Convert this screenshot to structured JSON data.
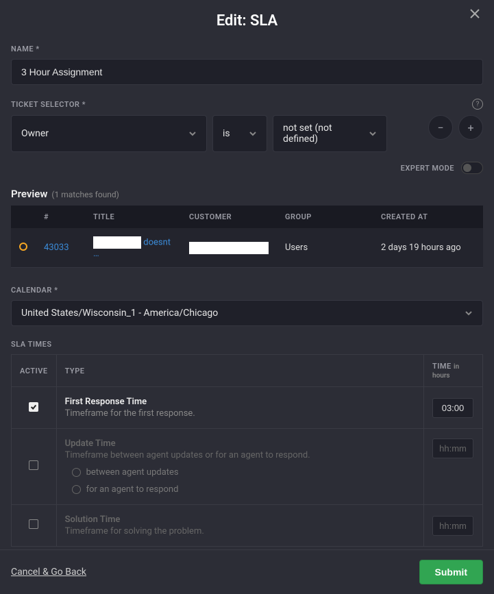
{
  "header": {
    "title": "Edit: SLA"
  },
  "name": {
    "label": "NAME *",
    "value": "3 Hour Assignment"
  },
  "ticket_selector": {
    "label": "TICKET SELECTOR *",
    "attribute": "Owner",
    "operator": "is",
    "value": "not set (not defined)"
  },
  "expert_mode": {
    "label": "EXPERT MODE",
    "enabled": false
  },
  "preview": {
    "title": "Preview",
    "count_text": "(1 matches found)",
    "columns": {
      "hash": "#",
      "title": "TITLE",
      "customer": "CUSTOMER",
      "group": "GROUP",
      "created": "CREATED AT"
    },
    "rows": [
      {
        "id": "43033",
        "title_suffix": "doesnt …",
        "group": "Users",
        "created": "2 days 19 hours ago"
      }
    ]
  },
  "calendar": {
    "label": "CALENDAR *",
    "value": "United States/Wisconsin_1 - America/Chicago"
  },
  "sla": {
    "label": "SLA TIMES",
    "headers": {
      "active": "ACTIVE",
      "type": "TYPE",
      "time": "TIME",
      "time_sub": "in hours"
    },
    "first_response": {
      "title": "First Response Time",
      "desc": "Timeframe for the first response.",
      "active": true,
      "time": "03:00"
    },
    "update_time": {
      "title": "Update Time",
      "desc": "Timeframe between agent updates or for an agent to respond.",
      "active": false,
      "time_placeholder": "hh:mm",
      "options": {
        "between": "between agent updates",
        "for_agent": "for an agent to respond"
      }
    },
    "solution_time": {
      "title": "Solution Time",
      "desc": "Timeframe for solving the problem.",
      "active": false,
      "time_placeholder": "hh:mm"
    }
  },
  "footer": {
    "cancel": "Cancel & Go Back",
    "submit": "Submit"
  }
}
